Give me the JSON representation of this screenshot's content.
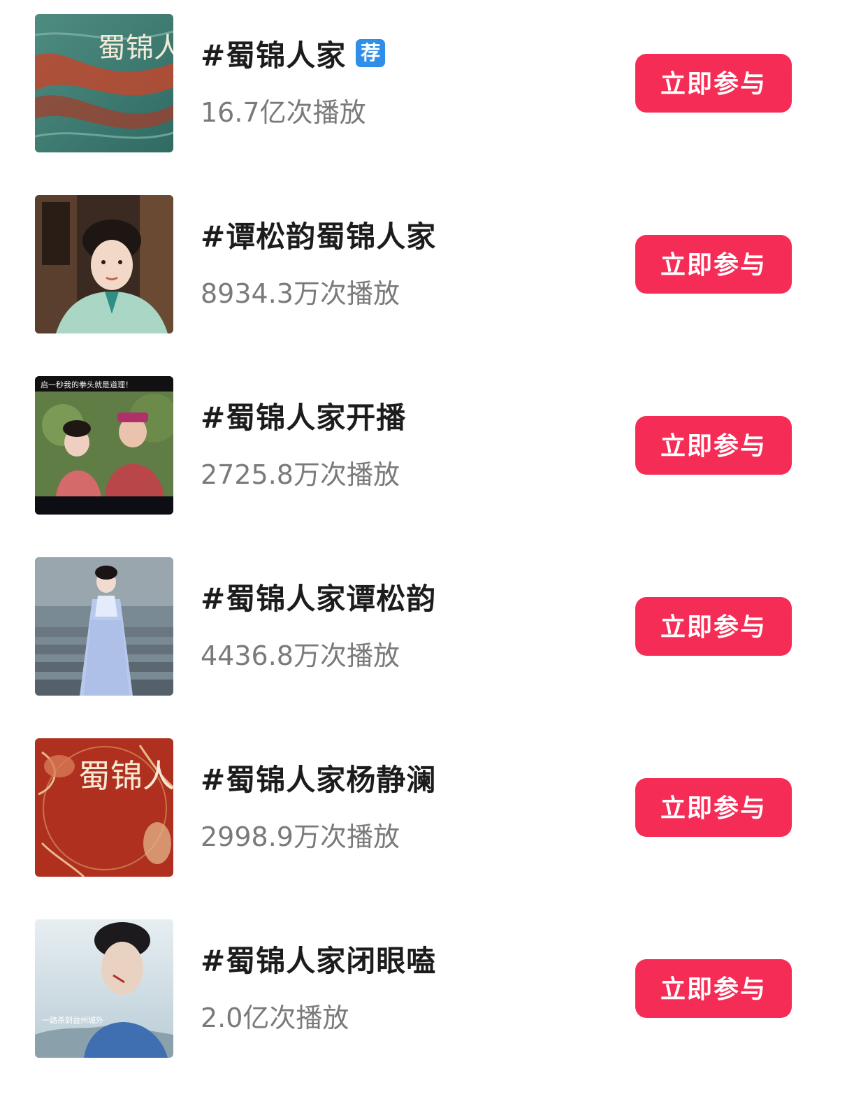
{
  "topics": [
    {
      "title": "#蜀锦人家",
      "badge": "荐",
      "plays": "16.7亿次播放",
      "button_label": "立即参与",
      "thumb_icon": "poster-calligraphy-teal-red",
      "thumb_text": "蜀锦人家"
    },
    {
      "title": "#谭松韵蜀锦人家",
      "plays": "8934.3万次播放",
      "button_label": "立即参与",
      "thumb_icon": "portrait-woman-green-robe"
    },
    {
      "title": "#蜀锦人家开播",
      "plays": "2725.8万次播放",
      "button_label": "立即参与",
      "thumb_icon": "still-two-characters-red",
      "thumb_text": "启一秒我的拳头就是道理！"
    },
    {
      "title": "#蜀锦人家谭松韵",
      "plays": "4436.8万次播放",
      "button_label": "立即参与",
      "thumb_icon": "woman-blue-dress-stairs"
    },
    {
      "title": "#蜀锦人家杨静澜",
      "plays": "2998.9万次播放",
      "button_label": "立即参与",
      "thumb_icon": "poster-calligraphy-red-floral",
      "thumb_text": "蜀锦人家"
    },
    {
      "title": "#蜀锦人家闭眼嗑",
      "plays": "2.0亿次播放",
      "button_label": "立即参与",
      "thumb_icon": "portrait-man-blue-robe",
      "thumb_text": "一路杀到益州城外"
    }
  ],
  "colors": {
    "button": "#f52d56",
    "badge": "#2f8fe8",
    "title": "#1c1c1c",
    "plays": "#7a7a7a"
  }
}
